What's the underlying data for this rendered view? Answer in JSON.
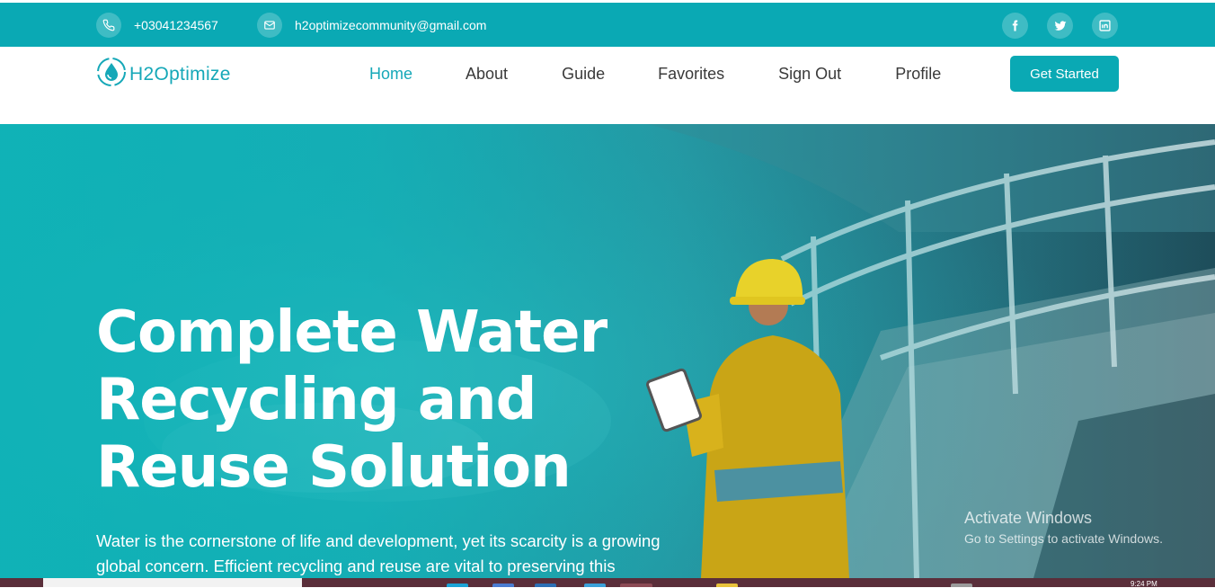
{
  "topbar": {
    "phone": "+03041234567",
    "email": "h2optimizecommunity@gmail.com",
    "phone_icon": "phone-icon",
    "email_icon": "mail-icon",
    "socials": [
      "facebook-icon",
      "twitter-icon",
      "linkedin-icon"
    ]
  },
  "brand": {
    "name": "H2Optimize",
    "icon": "water-drop-icon"
  },
  "nav": {
    "items": [
      "Home",
      "About",
      "Guide",
      "Favorites",
      "Sign Out",
      "Profile"
    ],
    "active": "Home",
    "cta": "Get Started"
  },
  "hero": {
    "title_line1": "Complete Water",
    "title_line2": "Recycling and",
    "title_line3": "Reuse Solution",
    "description_line1": "Water is the cornerstone of life and development, yet its scarcity is a growing",
    "description_line2": "global concern. Efficient recycling and reuse are vital to preserving this"
  },
  "watermark": {
    "title": "Activate Windows",
    "subtitle": "Go to Settings to activate Windows."
  },
  "taskbar": {
    "time": "9:24 PM"
  },
  "colors": {
    "accent": "#0aa9b4",
    "nav_text": "#3a3a3a",
    "active": "#16a8b8"
  }
}
